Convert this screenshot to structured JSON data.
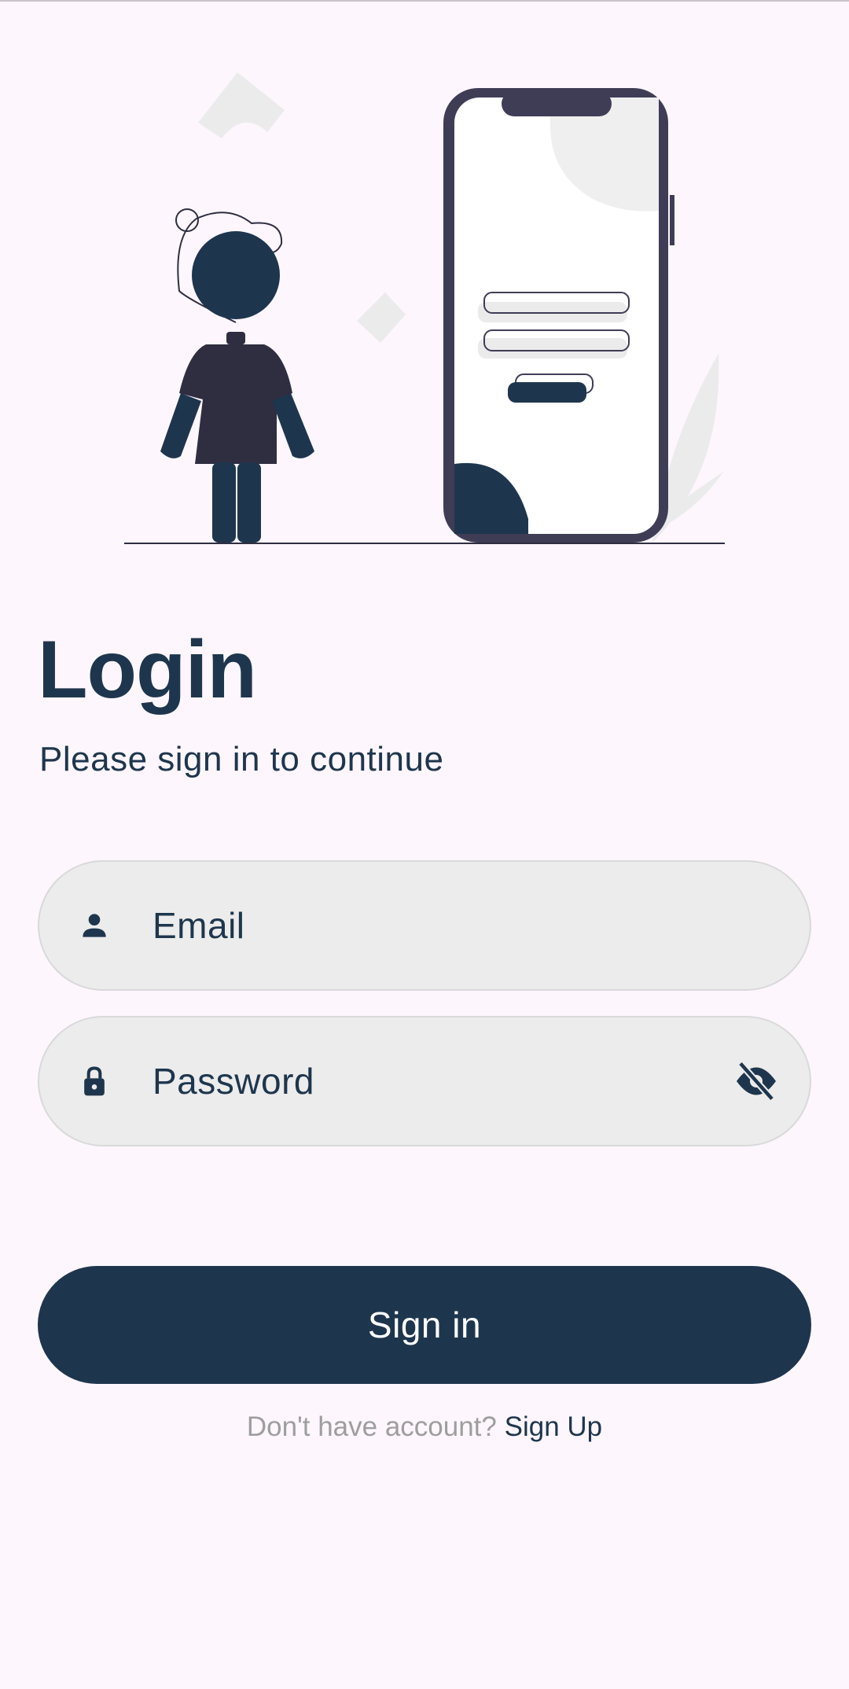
{
  "header": {
    "title": "Login",
    "subtitle": "Please sign in to continue"
  },
  "form": {
    "email": {
      "label": "Email",
      "icon": "person-icon"
    },
    "password": {
      "label": "Password",
      "icon": "lock-icon",
      "toggle_icon": "eye-off-icon"
    }
  },
  "actions": {
    "signin_label": "Sign in",
    "no_account_text": "Don't have account?",
    "signup_link": "Sign Up"
  },
  "colors": {
    "primary": "#1e364d",
    "background": "#fdf6fd",
    "field_bg": "#ececec"
  }
}
